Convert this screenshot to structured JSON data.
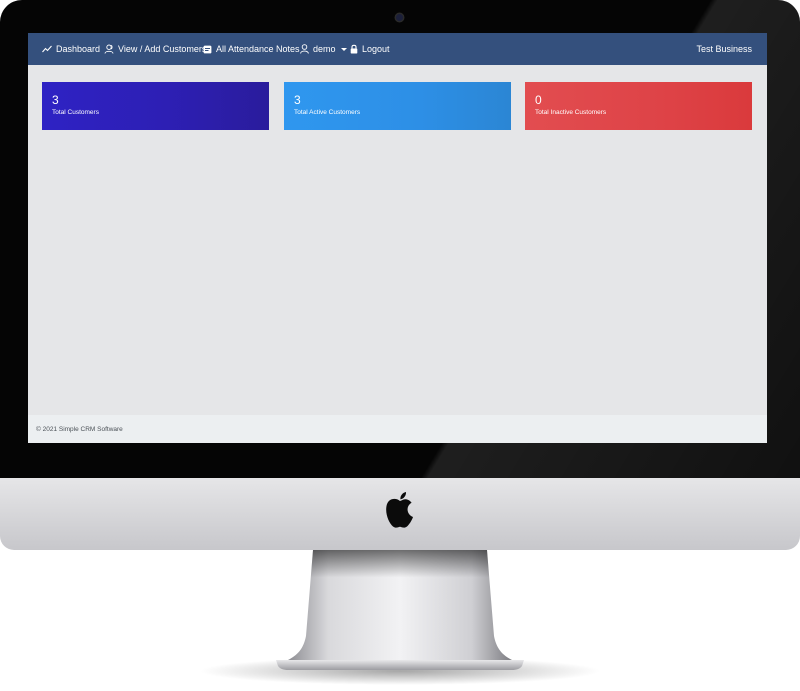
{
  "navbar": {
    "items": [
      {
        "label": "Dashboard",
        "icon": "trend-line-icon"
      },
      {
        "label": "View / Add Customers",
        "icon": "users-icon"
      },
      {
        "label": "All Attendance Notes",
        "icon": "notes-icon"
      },
      {
        "label": "demo",
        "icon": "user-icon"
      },
      {
        "label": "Logout",
        "icon": "lock-icon"
      }
    ],
    "brand": "Test Business",
    "background": "#34507d"
  },
  "stats": [
    {
      "value": "3",
      "label": "Total Customers",
      "color": "#2e22c4"
    },
    {
      "value": "3",
      "label": "Total Active Customers",
      "color": "#2f97ef"
    },
    {
      "value": "0",
      "label": "Total Inactive Customers",
      "color": "#e24d50"
    }
  ],
  "footer": {
    "text": "© 2021 Simple CRM Software"
  }
}
